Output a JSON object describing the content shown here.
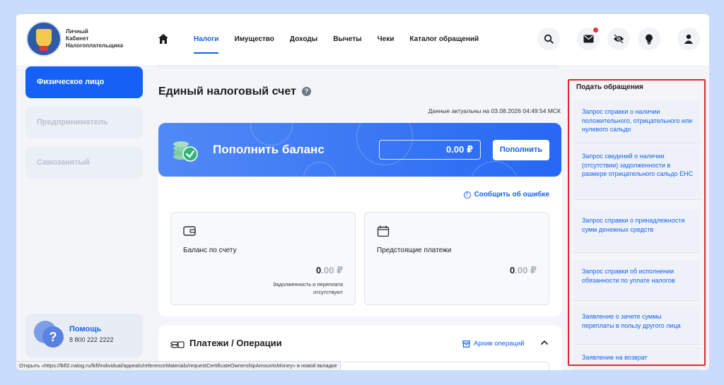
{
  "header": {
    "logo_lines": [
      "Личный",
      "Кабинет",
      "Налогоплательщика"
    ],
    "nav": [
      "Налоги",
      "Имущество",
      "Доходы",
      "Вычеты",
      "Чеки",
      "Каталог обращений"
    ],
    "active_nav": "Налоги",
    "icons": [
      "search-icon",
      "mail-icon",
      "eye-off-icon",
      "lightbulb-icon",
      "user-icon"
    ]
  },
  "sidebar": {
    "items": [
      {
        "label": "Физическое лицо",
        "active": true
      },
      {
        "label": "Предприниматель",
        "active": false
      },
      {
        "label": "Самозанятый",
        "active": false
      }
    ],
    "help_title": "Помощь",
    "help_phone": "8 800 222 2222"
  },
  "main": {
    "title": "Единый налоговый счет",
    "actual_date": "Данные актуальны на 03.08.2026 04:49:54 МСК",
    "banner_title": "Пополнить баланс",
    "amount_value": "0.00 ₽",
    "topup_button": "Пополнить",
    "report_link": "Сообщить об ошибке",
    "balance_label": "Баланс по счету",
    "balance_int": "0",
    "balance_dec": ".00 ₽",
    "balance_note": "Задолженность и переплата отсутствуют",
    "upcoming_label": "Предстоящие платежи",
    "upcoming_int": "0",
    "upcoming_dec": ".00 ₽",
    "payments_title": "Платежи / Операции",
    "archive_link": "Архив операций"
  },
  "appeals": {
    "title": "Подать обращения",
    "items": [
      "Запрос справки о наличии положительного, отрицательного или нулевого сальдо",
      "Запрос сведений о наличии (отсутствии) задолженности в размере отрицательного сальдо ЕНС",
      "Запрос справки о принадлежности сумм денежных средств",
      "Запрос справки об исполнении обязанности по уплате налогов",
      "Заявление о зачете суммы переплаты в пользу другого лица",
      "Заявление на возврат"
    ]
  },
  "statusbar": "Открыть «https://lkfl2.nalog.ru/lkfl/individual/appeals/referenceMaterials/requestCertificateOwnershipAmountsMoney» в новой вкладке",
  "colors": {
    "accent": "#1560f5",
    "highlight": "#e3262d"
  }
}
